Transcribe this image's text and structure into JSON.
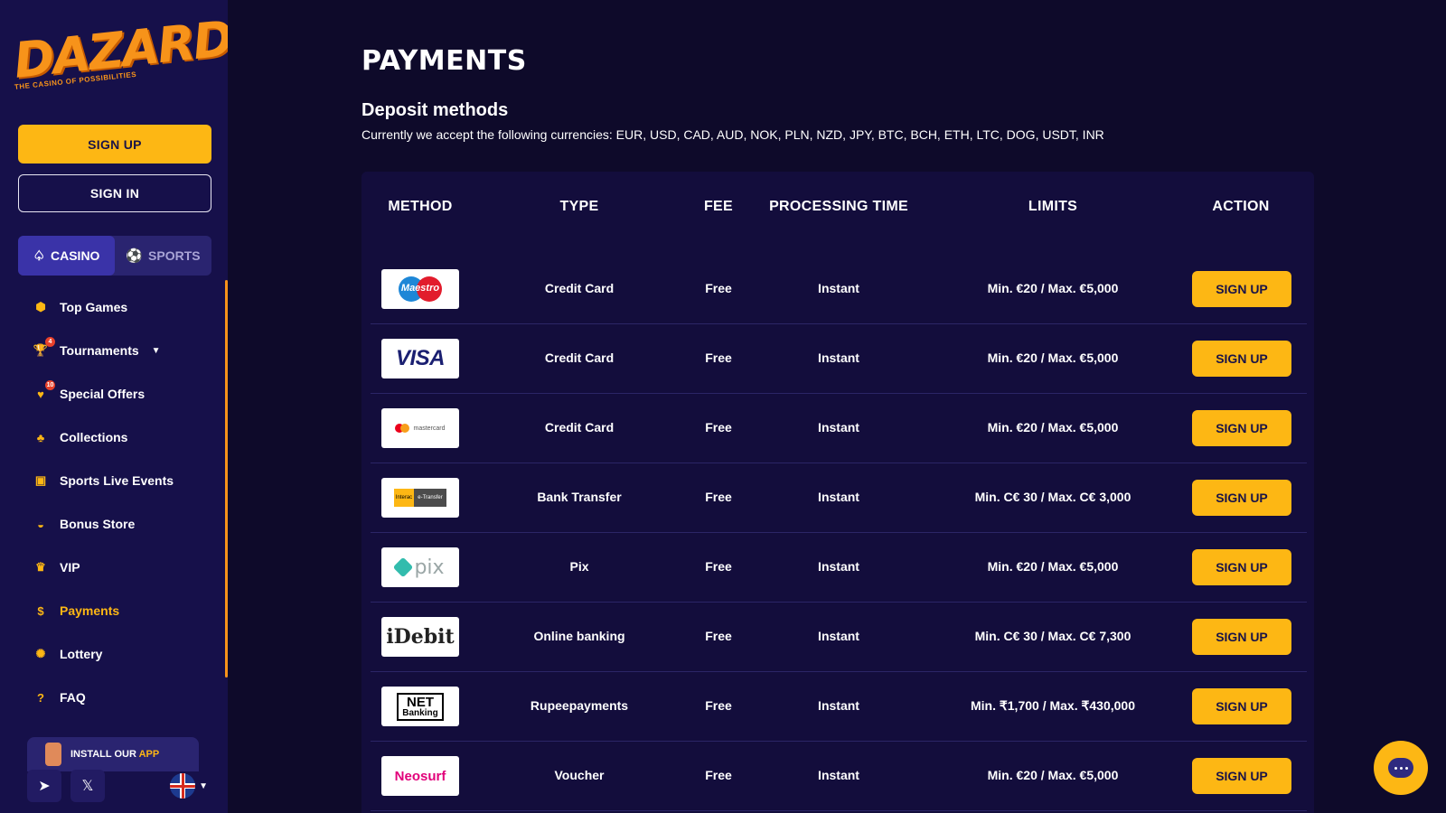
{
  "sidebar": {
    "logo": {
      "word": "DAZARD",
      "tagline": "THE CASINO OF POSSIBILITIES"
    },
    "signup_label": "SIGN UP",
    "signin_label": "SIGN IN",
    "modes": [
      {
        "label": "CASINO",
        "icon": "spade-icon",
        "active": true
      },
      {
        "label": "SPORTS",
        "icon": "ball-icon",
        "active": false
      }
    ],
    "items": [
      {
        "label": "Top Games",
        "icon": "dice-icon"
      },
      {
        "label": "Tournaments",
        "icon": "trophy-icon",
        "badge": "4"
      },
      {
        "label": "Special Offers",
        "icon": "tag-icon",
        "badge": "10"
      },
      {
        "label": "Collections",
        "icon": "cherries-icon"
      },
      {
        "label": "Sports Live Events",
        "icon": "live-icon"
      },
      {
        "label": "Bonus Store",
        "icon": "basket-icon"
      },
      {
        "label": "VIP",
        "icon": "crown-icon"
      },
      {
        "label": "Payments",
        "icon": "coin-icon",
        "active": true
      },
      {
        "label": "Lottery",
        "icon": "lottery-icon"
      },
      {
        "label": "FAQ",
        "icon": "question-icon"
      }
    ],
    "install_app": {
      "text": "INSTALL OUR",
      "accent": "APP"
    },
    "socials": [
      {
        "name": "telegram",
        "icon": "telegram-icon"
      },
      {
        "name": "x",
        "icon": "x-icon"
      }
    ],
    "language": "uk-flag"
  },
  "main": {
    "title": "PAYMENTS",
    "section_title": "Deposit methods",
    "currencies_text": "Currently we accept the following currencies: EUR, USD, CAD, AUD, NOK, PLN, NZD, JPY, BTC, BCH, ETH, LTC, DOG, USDT, INR",
    "table": {
      "headers": [
        "METHOD",
        "TYPE",
        "FEE",
        "PROCESSING TIME",
        "LIMITS",
        "ACTION"
      ],
      "rows": [
        {
          "method": "Maestro",
          "logo": "maestro",
          "type": "Credit Card",
          "fee": "Free",
          "time": "Instant",
          "limits": "Min. €20 / Max. €5,000",
          "action": "SIGN UP"
        },
        {
          "method": "VISA",
          "logo": "visa",
          "type": "Credit Card",
          "fee": "Free",
          "time": "Instant",
          "limits": "Min. €20 / Max. €5,000",
          "action": "SIGN UP"
        },
        {
          "method": "mastercard",
          "logo": "mastercard",
          "type": "Credit Card",
          "fee": "Free",
          "time": "Instant",
          "limits": "Min. €20 / Max. €5,000",
          "action": "SIGN UP"
        },
        {
          "method": "Interac e-Transfer",
          "logo": "interac",
          "type": "Bank Transfer",
          "fee": "Free",
          "time": "Instant",
          "limits": "Min. C€ 30 / Max. C€ 3,000",
          "action": "SIGN UP"
        },
        {
          "method": "pix",
          "logo": "pix",
          "type": "Pix",
          "fee": "Free",
          "time": "Instant",
          "limits": "Min. €20 / Max. €5,000",
          "action": "SIGN UP"
        },
        {
          "method": "iDebit",
          "logo": "idebit",
          "type": "Online banking",
          "fee": "Free",
          "time": "Instant",
          "limits": "Min. C€ 30 / Max. C€ 7,300",
          "action": "SIGN UP"
        },
        {
          "method": "NET Banking",
          "logo": "netbanking",
          "type": "Rupeepayments",
          "fee": "Free",
          "time": "Instant",
          "limits": "Min. ₹1,700 / Max. ₹430,000",
          "action": "SIGN UP"
        },
        {
          "method": "Neosurf",
          "logo": "neosurf",
          "type": "Voucher",
          "fee": "Free",
          "time": "Instant",
          "limits": "Min. €20 / Max. €5,000",
          "action": "SIGN UP"
        }
      ]
    }
  },
  "chat": {
    "icon": "chat-icon"
  },
  "colors": {
    "background": "#0e0a2a",
    "sidebar": "#16104a",
    "accent": "#fdb714",
    "table": "#130d3c"
  }
}
